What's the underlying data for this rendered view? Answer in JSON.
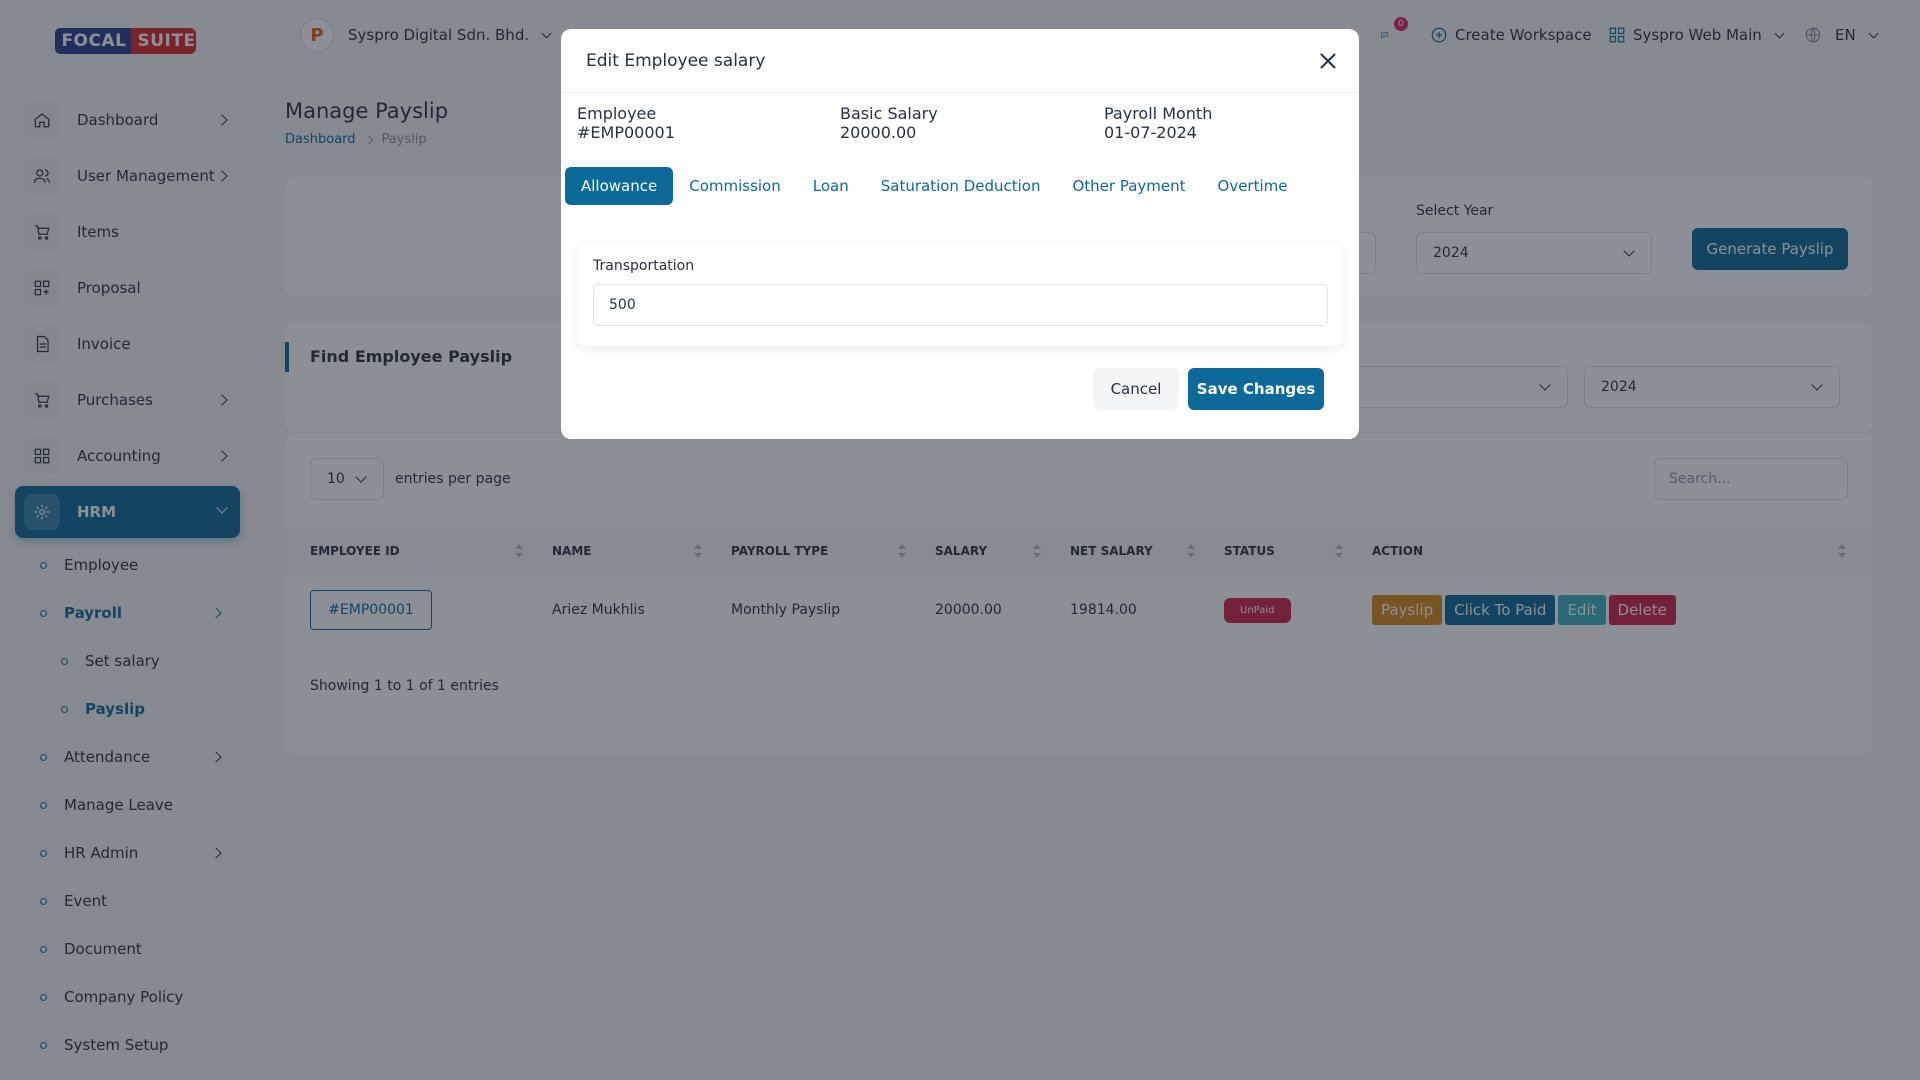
{
  "brand": {
    "logo_left": "FOCAL",
    "logo_right": "SUITE"
  },
  "header": {
    "company": "Syspro Digital Sdn. Bhd.",
    "company_logo_letter": "P",
    "notification_count": "0",
    "create_workspace": "Create Workspace",
    "workspace": "Syspro Web Main",
    "language": "EN"
  },
  "sidebar": {
    "items": [
      {
        "label": "Dashboard",
        "icon": "home-icon"
      },
      {
        "label": "User Management",
        "icon": "users-icon"
      },
      {
        "label": "Items",
        "icon": "cart-icon"
      },
      {
        "label": "Proposal",
        "icon": "proposal-icon"
      },
      {
        "label": "Invoice",
        "icon": "invoice-icon"
      },
      {
        "label": "Purchases",
        "icon": "purchase-icon"
      },
      {
        "label": "Accounting",
        "icon": "accounting-icon"
      },
      {
        "label": "HRM",
        "icon": "hrm-icon"
      }
    ],
    "hrm_sub": {
      "employee": "Employee",
      "payroll": "Payroll",
      "set_salary": "Set salary",
      "payslip": "Payslip",
      "attendance": "Attendance",
      "manage_leave": "Manage Leave",
      "hr_admin": "HR Admin",
      "event": "Event",
      "document": "Document",
      "company_policy": "Company Policy",
      "system_setup": "System Setup"
    }
  },
  "page": {
    "title": "Manage Payslip",
    "breadcrumb": {
      "home": "Dashboard",
      "current": "Payslip"
    },
    "filter": {
      "year_label": "Select Year",
      "year_value": "2024",
      "generate_button": "Generate Payslip"
    },
    "find": {
      "title": "Find Employee Payslip",
      "year_value": "2024"
    },
    "table": {
      "page_size": "10",
      "entries_label": "entries per page",
      "search_placeholder": "Search...",
      "headers": {
        "employee_id": "EMPLOYEE ID",
        "name": "NAME",
        "payroll_type": "PAYROLL TYPE",
        "salary": "SALARY",
        "net_salary": "NET SALARY",
        "status": "STATUS",
        "action": "ACTION"
      },
      "rows": [
        {
          "employee_id": "#EMP00001",
          "name": "Ariez Mukhlis",
          "payroll_type": "Monthly Payslip",
          "salary": "20000.00",
          "net_salary": "19814.00",
          "status": "UnPaid"
        }
      ],
      "actions": {
        "payslip": "Payslip",
        "paid": "Click To Paid",
        "edit": "Edit",
        "delete": "Delete"
      },
      "showing": "Showing 1 to 1 of 1 entries"
    }
  },
  "modal": {
    "title": "Edit Employee salary",
    "employee_label": "Employee",
    "employee_value": "#EMP00001",
    "basic_label": "Basic Salary",
    "basic_value": "20000.00",
    "month_label": "Payroll Month",
    "month_value": "01-07-2024",
    "tabs": [
      "Allowance",
      "Commission",
      "Loan",
      "Saturation Deduction",
      "Other Payment",
      "Overtime"
    ],
    "field_label": "Transportation",
    "field_value": "500",
    "cancel": "Cancel",
    "save": "Save Changes"
  }
}
